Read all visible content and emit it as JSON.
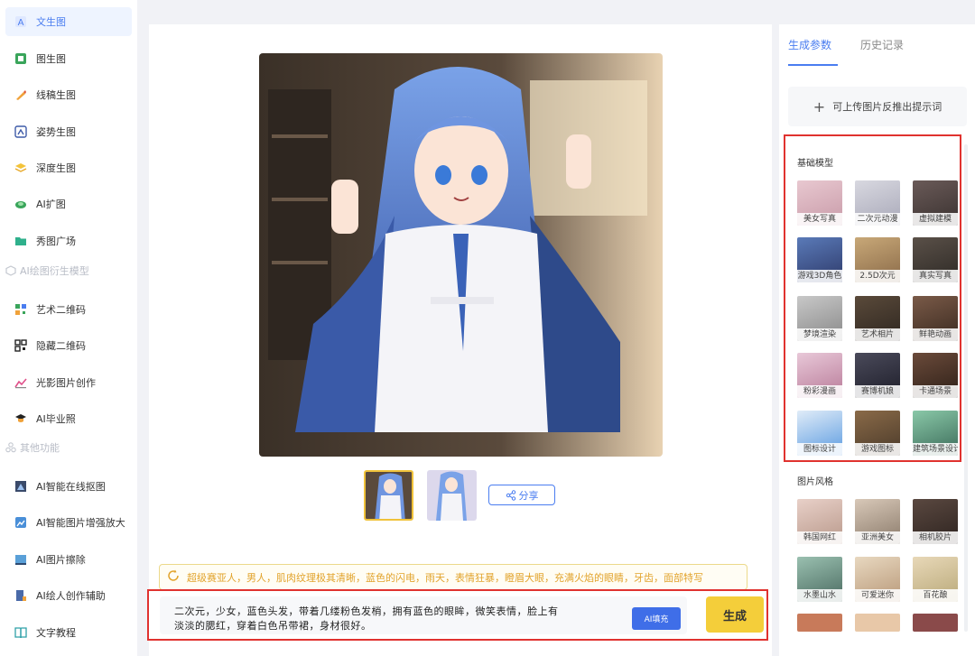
{
  "sidebar": {
    "items": [
      {
        "label": "文生图",
        "icon": "text-to-image-icon",
        "active": true
      },
      {
        "label": "图生图",
        "icon": "image-to-image-icon"
      },
      {
        "label": "线稿生图",
        "icon": "lineart-icon"
      },
      {
        "label": "姿势生图",
        "icon": "pose-icon"
      },
      {
        "label": "深度生图",
        "icon": "depth-icon"
      },
      {
        "label": "AI扩图",
        "icon": "expand-icon"
      },
      {
        "label": "秀图广场",
        "icon": "gallery-icon"
      }
    ],
    "section1": "AI绘图衍生模型",
    "items2": [
      {
        "label": "艺术二维码",
        "icon": "art-qrcode-icon"
      },
      {
        "label": "隐藏二维码",
        "icon": "hidden-qrcode-icon"
      },
      {
        "label": "光影图片创作",
        "icon": "light-shadow-icon"
      },
      {
        "label": "AI毕业照",
        "icon": "graduation-cap-icon"
      }
    ],
    "section2": "其他功能",
    "items3": [
      {
        "label": "AI智能在线抠图",
        "icon": "cutout-icon"
      },
      {
        "label": "AI智能图片增强放大",
        "icon": "enhance-icon"
      },
      {
        "label": "AI图片擦除",
        "icon": "erase-icon"
      },
      {
        "label": "AI绘人创作辅助",
        "icon": "figure-assist-icon"
      },
      {
        "label": "文字教程",
        "icon": "book-icon"
      }
    ]
  },
  "main": {
    "share_label": "分享",
    "suggestion": "超级赛亚人，男人，肌肉纹理极其清晰，蓝色的闪电，雨天，表情狂暴，瞪眉大眼，充满火焰的眼睛，牙齿，面部特写",
    "prompt_line1": "二次元，少女，蓝色头发，带着几缕粉色发梢，拥有蓝色的眼眸，微笑表情，脸上有",
    "prompt_line2": "淡淡的腮红，穿着白色吊带裙，身材很好。",
    "ai_fill_label": "AI填充",
    "generate_label": "生成"
  },
  "right": {
    "tab_params": "生成参数",
    "tab_history": "历史记录",
    "upload_label": "可上传图片反推出提示词",
    "base_model_title": "基础模型",
    "base_models": [
      "美女写真",
      "二次元动漫",
      "虚拟建模",
      "游戏3D角色",
      "2.5D次元",
      "真实写真",
      "梦境渲染",
      "艺术相片",
      "鲜艳动画",
      "粉彩漫画",
      "赛博机娘",
      "卡通场景",
      "图标设计",
      "游戏图标",
      "建筑场景设计"
    ],
    "style_title": "图片风格",
    "styles": [
      "韩国网红",
      "亚洲美女",
      "相机胶片",
      "水墨山水",
      "可爱迷你",
      "百花酿"
    ]
  },
  "colors": {
    "accent": "#4a7df0",
    "highlight_red": "#e0322f",
    "generate_yellow": "#f4ce3a",
    "suggest_orange": "#e2a32b"
  }
}
